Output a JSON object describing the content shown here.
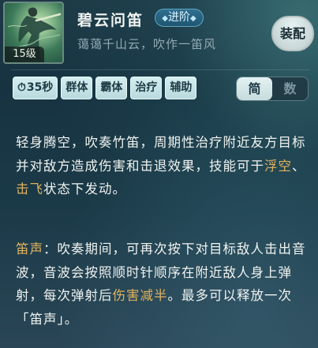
{
  "skill": {
    "name": "碧云问笛",
    "tag": "进阶",
    "subtitle": "蔼蔼千山云，吹作一笛风",
    "level": "15级",
    "icon": "flute-player-icon"
  },
  "equip_button": "装配",
  "chips": {
    "cooldown": "35秒",
    "items": [
      "群体",
      "霸体",
      "治疗",
      "辅助"
    ]
  },
  "mode_toggle": {
    "simple": "简",
    "numeric": "数",
    "selected": "简"
  },
  "description": {
    "p1_a": "轻身腾空，吹奏竹笛，周期性治疗附近友方目标并对敌方造成伤害和击退效果，技能可于",
    "p1_hl1": "浮空",
    "p1_b": "、",
    "p1_hl2": "击飞",
    "p1_c": "状态下发动。",
    "p2_hl": "笛声",
    "p2_a": "：吹奏期间，可再次按下对目标敌人击出音波，音波会按照顺时针顺序在附近敌人身上弹射，每次弹射后",
    "p2_hl2": "伤害减半",
    "p2_b": "。最多可以释放一次「笛声」。"
  },
  "colors": {
    "highlight": "#e0b25e",
    "text": "#f0f3f0",
    "subtitle": "#93aab3"
  }
}
